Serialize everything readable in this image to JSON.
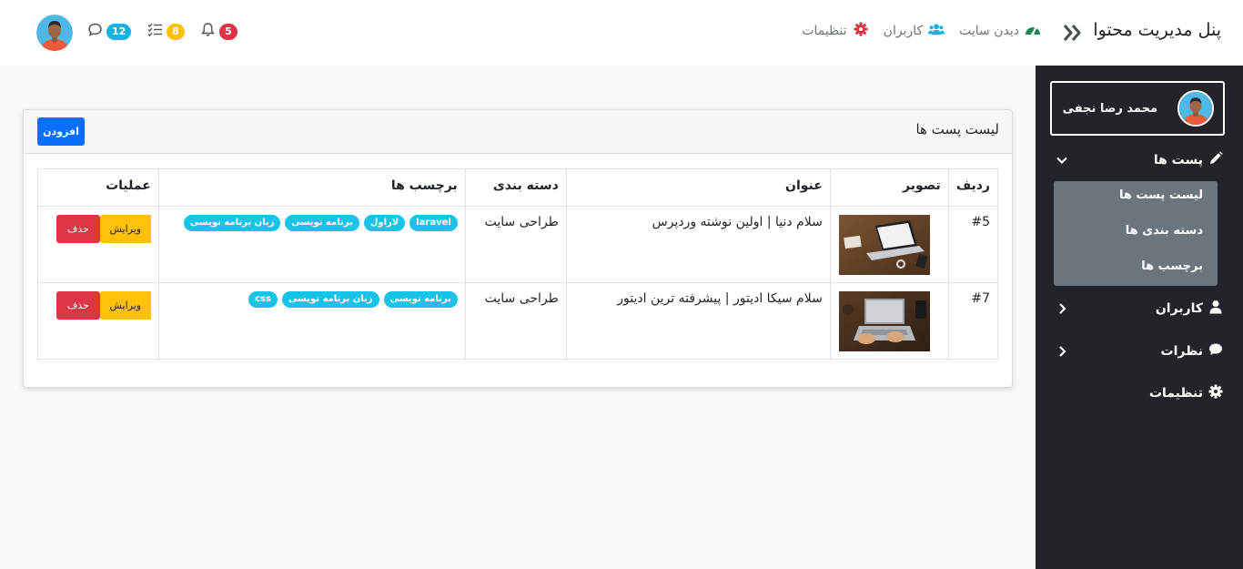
{
  "header": {
    "brand": "پنل مدیریت محتوا",
    "links": [
      {
        "label": "دیدن سایت",
        "icon": "gauge-icon",
        "color": "#198754"
      },
      {
        "label": "کاربران",
        "icon": "users-icon",
        "color": "#17b2e0"
      },
      {
        "label": "تنظیمات",
        "icon": "gear-icon",
        "color": "#dc3545"
      }
    ],
    "notifications": "5",
    "tasks": "8",
    "messages": "12"
  },
  "sidebar": {
    "user_name": "محمد رضا نجفی",
    "items": [
      {
        "label": "پست ها",
        "icon": "pencil-icon"
      },
      {
        "label": "کاربران",
        "icon": "user-icon"
      },
      {
        "label": "نظرات",
        "icon": "comment-icon"
      },
      {
        "label": "تنظیمات",
        "icon": "gear-icon"
      }
    ],
    "submenu": [
      "لیست پست ها",
      "دسته بندی ها",
      "برچسب ها"
    ]
  },
  "card": {
    "title": "لیست پست ها",
    "add_label": "افزودن"
  },
  "table": {
    "columns": [
      "ردیف",
      "تصویر",
      "عنوان",
      "دسته بندی",
      "برچسب ها",
      "عملیات"
    ],
    "rows": [
      {
        "id": "#5",
        "title": "سلام دنیا | اولین نوشته وردپرس",
        "category": "طراحی سایت",
        "tags": [
          "laravel",
          "لاراول",
          "برنامه نویسی",
          "زبان برنامه نویسی"
        ]
      },
      {
        "id": "#7",
        "title": "سلام سیکا ادیتور | پیشرفته ترین ادیتور",
        "category": "طراحی سایت",
        "tags": [
          "برنامه نویسی",
          "زبان برنامه نویسی",
          "css"
        ]
      }
    ],
    "edit_label": "ویرایش",
    "delete_label": "حذف"
  }
}
